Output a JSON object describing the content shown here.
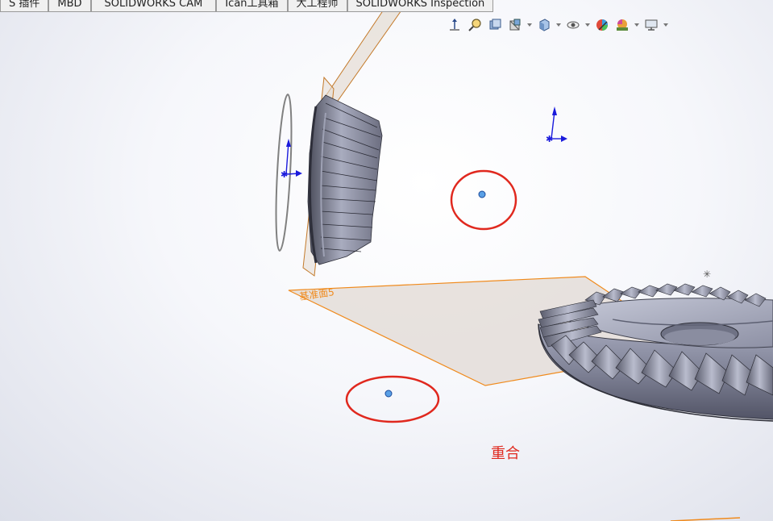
{
  "tabs": [
    {
      "label": "S 插件"
    },
    {
      "label": "MBD"
    },
    {
      "label": "SOLIDWORKS CAM"
    },
    {
      "label": "Ican工具箱"
    },
    {
      "label": "大工程师"
    },
    {
      "label": "SOLIDWORKS Inspection"
    }
  ],
  "toolbar": {
    "icons": [
      "view-orientation-icon",
      "zoom-to-area-icon",
      "previous-view-icon",
      "section-view-icon",
      "display-style-icon",
      "hide-show-icon",
      "edit-appearance-icon",
      "apply-scene-icon",
      "view-settings-icon"
    ]
  },
  "viewport": {
    "plane_label": "基准面5",
    "annotation": "重合"
  },
  "colors": {
    "highlight_circle": "#e0281e",
    "plane_edge": "#f08a1c",
    "plane_fill": "#e4ddd8",
    "gear_face": "#7d8095",
    "gear_light": "#b4b8cc",
    "gear_dark": "#40424f",
    "axis_blue": "#1a1adc"
  }
}
